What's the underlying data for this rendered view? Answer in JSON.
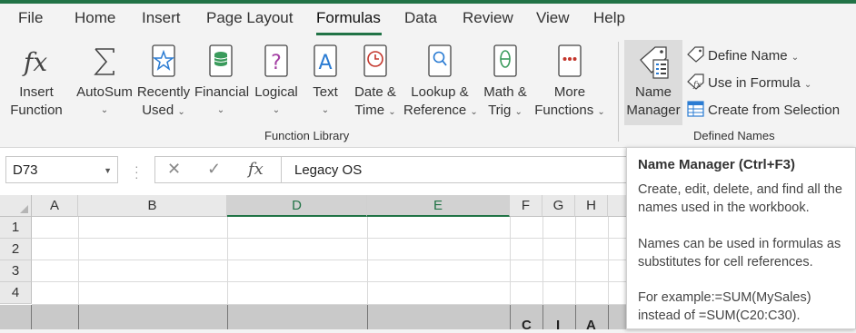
{
  "tabs": [
    "File",
    "Home",
    "Insert",
    "Page Layout",
    "Formulas",
    "Data",
    "Review",
    "View",
    "Help"
  ],
  "active_tab": "Formulas",
  "accent_color": "#217346",
  "function_library": {
    "buttons": [
      {
        "line1": "Insert",
        "line2": "Function",
        "icon": "fx-icon"
      },
      {
        "line1": "AutoSum",
        "line2": "",
        "icon": "sigma-icon"
      },
      {
        "line1": "Recently",
        "line2": "Used",
        "icon": "star-book-icon"
      },
      {
        "line1": "Financial",
        "line2": "",
        "icon": "coins-book-icon"
      },
      {
        "line1": "Logical",
        "line2": "",
        "icon": "question-book-icon"
      },
      {
        "line1": "Text",
        "line2": "",
        "icon": "letter-a-book-icon"
      },
      {
        "line1": "Date &",
        "line2": "Time",
        "icon": "clock-book-icon"
      },
      {
        "line1": "Lookup &",
        "line2": "Reference",
        "icon": "magnifier-book-icon"
      },
      {
        "line1": "Math &",
        "line2": "Trig",
        "icon": "theta-book-icon"
      },
      {
        "line1": "More",
        "line2": "Functions",
        "icon": "dots-book-icon"
      }
    ],
    "label": "Function Library"
  },
  "defined_names": {
    "name_manager": {
      "line1": "Name",
      "line2": "Manager"
    },
    "define_name": "Define Name",
    "use_in_formula": "Use in Formula",
    "create_from_selection": "Create from Selection",
    "label": "Defined Names"
  },
  "name_box": {
    "value": "D73"
  },
  "formula_bar": {
    "value": "Legacy OS",
    "fx": "fx"
  },
  "columns": [
    "A",
    "B",
    "D",
    "E",
    "F",
    "G",
    "H"
  ],
  "rows": [
    "1",
    "2",
    "3",
    "4"
  ],
  "partial_row_text": [
    "C",
    "I",
    "A"
  ],
  "tooltip": {
    "title": "Name Manager (Ctrl+F3)",
    "para1": "Create, edit, delete, and find all the names used in the workbook.",
    "para2": "Names can be used in formulas as substitutes for cell references.",
    "para3_line1": "For example:=SUM(MySales)",
    "para3_line2": "instead of =SUM(C20:C30)."
  }
}
